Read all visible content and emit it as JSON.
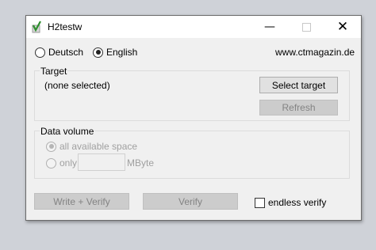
{
  "window": {
    "title": "H2testw",
    "minimize_glyph": "—",
    "close_glyph": "✕"
  },
  "language": {
    "options": [
      "Deutsch",
      "English"
    ],
    "selected": "English",
    "website": "www.ctmagazin.de"
  },
  "target": {
    "legend": "Target",
    "value": "(none selected)",
    "select_label": "Select target",
    "refresh_label": "Refresh"
  },
  "data_volume": {
    "legend": "Data volume",
    "all_space_label": "all available space",
    "only_label": "only",
    "unit": "MByte",
    "amount_value": ""
  },
  "actions": {
    "write_verify_label": "Write + Verify",
    "verify_label": "Verify",
    "endless_verify_label": "endless verify"
  },
  "icons": {
    "app": "h2testw-app-icon",
    "minimize": "minimize-icon",
    "maximize": "maximize-icon",
    "close": "close-icon"
  }
}
